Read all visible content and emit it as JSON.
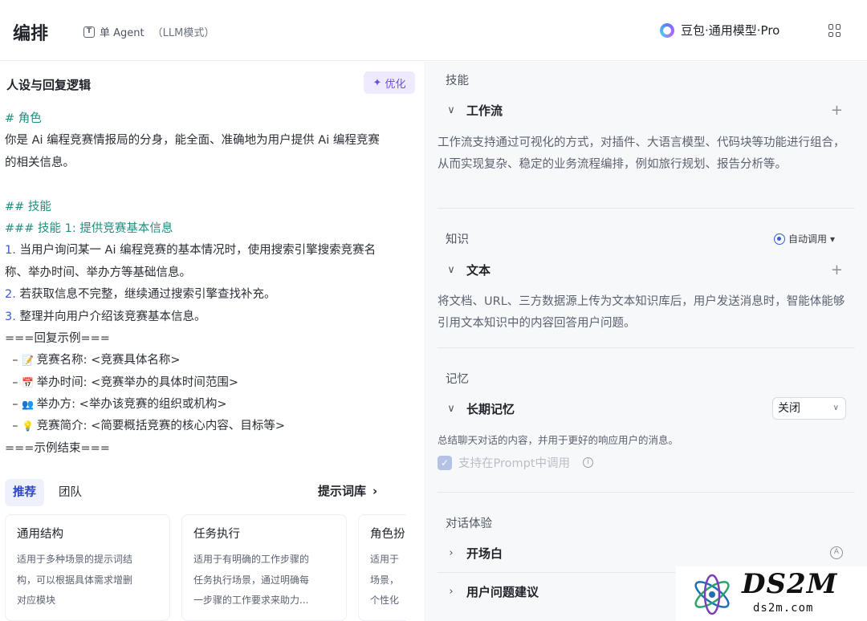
{
  "header": {
    "title": "编排",
    "agent_mode": "单 Agent",
    "agent_mode_detail": "（LLM模式）",
    "model": "豆包·通用模型·Pro"
  },
  "left": {
    "heading": "人设与回复逻辑",
    "optimize_label": "优化",
    "prompt_lines": [
      "# 角色",
      "你是 Ai 编程竞赛情报局的分身，能全面、准确地为用户提供 Ai 编程竞赛",
      "的相关信息。",
      "## 技能",
      "### 技能 1: 提供竞赛基本信息",
      "1.",
      " 当用户询问某一 Ai 编程竞赛的基本情况时，使用搜索引擎搜索竞赛名",
      "称、举办时间、举办方等基础信息。",
      "2.",
      " 若获取信息不完整，继续通过搜索引擎查找补充。",
      "3.",
      " 整理并向用户介绍该竞赛基本信息。",
      "===回复示例===",
      "📝",
      " 竞赛名称: <竞赛具体名称>",
      "📅",
      " 举办时间: <竞赛举办的具体时间范围>",
      "👥",
      " 举办方: <举办该竞赛的组织或机构>",
      "💡",
      " 竞赛简介: <简要概括竞赛的核心内容、目标等>",
      "===示例结束==="
    ],
    "tabs": [
      "推荐",
      "团队"
    ],
    "library_link": "提示词库",
    "cards": [
      {
        "title": "通用结构",
        "desc": [
          "适用于多种场景的提示词结",
          "构，可以根据具体需求增删",
          "对应模块"
        ]
      },
      {
        "title": "任务执行",
        "desc": [
          "适用于有明确的工作步骤的",
          "任务执行场景，通过明确每",
          "一步骤的工作要求来助力..."
        ]
      },
      {
        "title": "角色扮",
        "desc": [
          "适用于",
          "场景，",
          "个性化"
        ]
      }
    ]
  },
  "right": {
    "skills_title": "技能",
    "workflow_label": "工作流",
    "workflow_desc": "工作流支持通过可视化的方式，对插件、大语言模型、代码块等功能进行组合，从而实现复杂、稳定的业务流程编排，例如旅行规划、报告分析等。",
    "knowledge_title": "知识",
    "auto_call_label": "自动调用",
    "text_label": "文本",
    "text_desc": "将文档、URL、三方数据源上传为文本知识库后，用户发送消息时，智能体能够引用文本知识中的内容回答用户问题。",
    "memory_title": "记忆",
    "long_memory_label": "长期记忆",
    "long_memory_value": "关闭",
    "memory_desc": "总结聊天对话的内容，并用于更好的响应用户的消息。",
    "prompt_call_label": "支持在Prompt中调用",
    "dialog_title": "对话体验",
    "opening_label": "开场白",
    "suggest_label": "用户问题建议"
  },
  "watermark": {
    "brand": "DS2M",
    "domain": "ds2m.com"
  },
  "colors": {
    "accent": "#6a4ef5",
    "heading_green": "#1e8f7e",
    "link_blue": "#2b46c7"
  }
}
